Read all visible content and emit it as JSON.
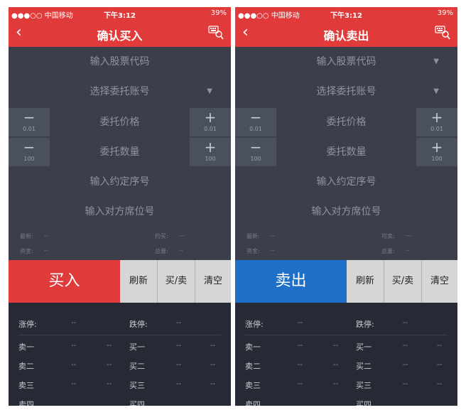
{
  "status": {
    "signal": "●●●○○ 中国移动",
    "time": "下午3:12",
    "battery": "39%"
  },
  "colors": {
    "header_red": "#e03a3a",
    "buy_red": "#e03a3a",
    "sell_blue": "#1f6fc9",
    "panel": "#3a3f4a",
    "quote_bg": "#262a34"
  },
  "icons": {
    "back": "chevron-left-icon",
    "keyboard": "keyboard-search-icon",
    "dropdown": "chevron-down-icon",
    "plus": "plus-icon",
    "minus": "minus-icon"
  },
  "form": {
    "stock_code_placeholder": "输入股票代码",
    "account_placeholder": "选择委托账号",
    "price_label": "委托价格",
    "quantity_label": "委托数量",
    "contract_placeholder": "输入约定序号",
    "counterparty_placeholder": "输入对方席位号",
    "minus_symbol": "−",
    "plus_symbol": "+",
    "price_step": "0.01",
    "quantity_step": "100"
  },
  "info": {
    "latest_label": "最新:",
    "latest_value": "--",
    "funds_label": "资金:",
    "funds_value": "--",
    "total_label": "总量:",
    "total_value": "--",
    "dash": "---"
  },
  "buttons": {
    "refresh": "刷新",
    "switch": "买/卖",
    "clear": "清空"
  },
  "quotes": {
    "limit_up_label": "涨停:",
    "limit_up_value": "--",
    "limit_down_label": "跌停:",
    "limit_down_value": "--",
    "dash": "--",
    "sell1": "卖一",
    "sell2": "卖二",
    "sell3": "卖三",
    "sell4": "卖四",
    "buy1": "买一",
    "buy2": "买二",
    "buy3": "买三",
    "buy4": "买四"
  },
  "left": {
    "title": "确认买入",
    "action": "买入",
    "available_label": "约买:"
  },
  "right": {
    "title": "确认卖出",
    "action": "卖出",
    "available_label": "可卖:"
  }
}
